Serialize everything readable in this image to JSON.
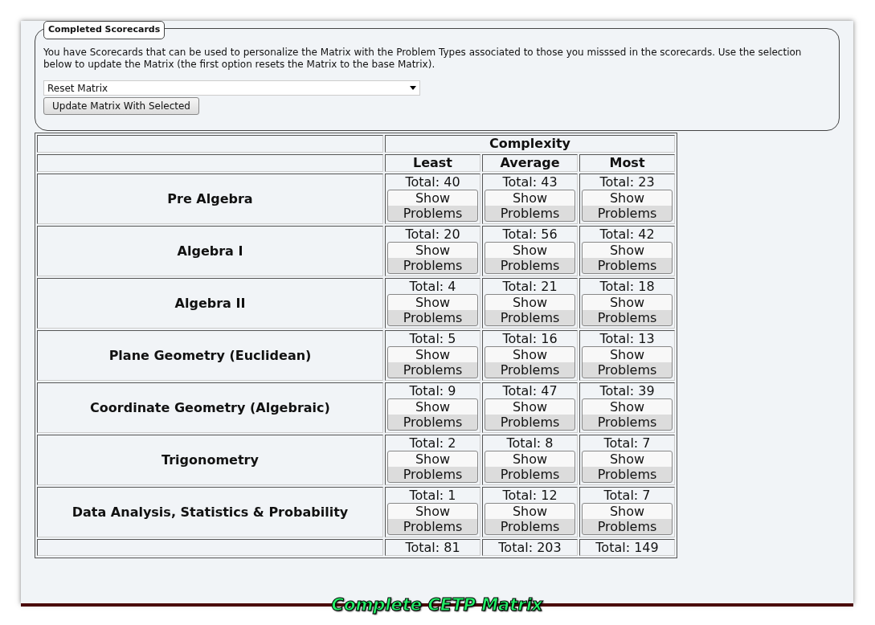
{
  "scorecards": {
    "legend": "Completed Scorecards",
    "description": "You have Scorecards that can be used to personalize the Matrix with the Problem Types associated to those you misssed in the scorecards. Use the selection below to update the Matrix (the first option resets the Matrix to the base Matrix).",
    "select": {
      "value": "Reset Matrix"
    },
    "update_button": "Update Matrix With Selected"
  },
  "matrix": {
    "group_header": "Complexity",
    "columns": [
      "Least",
      "Average",
      "Most"
    ],
    "rows": [
      {
        "label": "Pre Algebra",
        "cells": [
          {
            "total": "Total: 40",
            "button": "Show Problems"
          },
          {
            "total": "Total: 43",
            "button": "Show Problems"
          },
          {
            "total": "Total: 23",
            "button": "Show Problems"
          }
        ]
      },
      {
        "label": "Algebra I",
        "cells": [
          {
            "total": "Total: 20",
            "button": "Show Problems"
          },
          {
            "total": "Total: 56",
            "button": "Show Problems"
          },
          {
            "total": "Total: 42",
            "button": "Show Problems"
          }
        ]
      },
      {
        "label": "Algebra II",
        "cells": [
          {
            "total": "Total: 4",
            "button": "Show Problems"
          },
          {
            "total": "Total: 21",
            "button": "Show Problems"
          },
          {
            "total": "Total: 18",
            "button": "Show Problems"
          }
        ]
      },
      {
        "label": "Plane Geometry (Euclidean)",
        "cells": [
          {
            "total": "Total: 5",
            "button": "Show Problems"
          },
          {
            "total": "Total: 16",
            "button": "Show Problems"
          },
          {
            "total": "Total: 13",
            "button": "Show Problems"
          }
        ]
      },
      {
        "label": "Coordinate Geometry (Algebraic)",
        "cells": [
          {
            "total": "Total: 9",
            "button": "Show Problems"
          },
          {
            "total": "Total: 47",
            "button": "Show Problems"
          },
          {
            "total": "Total: 39",
            "button": "Show Problems"
          }
        ]
      },
      {
        "label": "Trigonometry",
        "cells": [
          {
            "total": "Total: 2",
            "button": "Show Problems"
          },
          {
            "total": "Total: 8",
            "button": "Show Problems"
          },
          {
            "total": "Total: 7",
            "button": "Show Problems"
          }
        ]
      },
      {
        "label": "Data Analysis, Statistics & Probability",
        "cells": [
          {
            "total": "Total: 1",
            "button": "Show Problems"
          },
          {
            "total": "Total: 12",
            "button": "Show Problems"
          },
          {
            "total": "Total: 7",
            "button": "Show Problems"
          }
        ]
      }
    ],
    "footer_totals": [
      "Total: 81",
      "Total: 203",
      "Total: 149"
    ]
  },
  "footer_title": "Complete CETP Matrix"
}
